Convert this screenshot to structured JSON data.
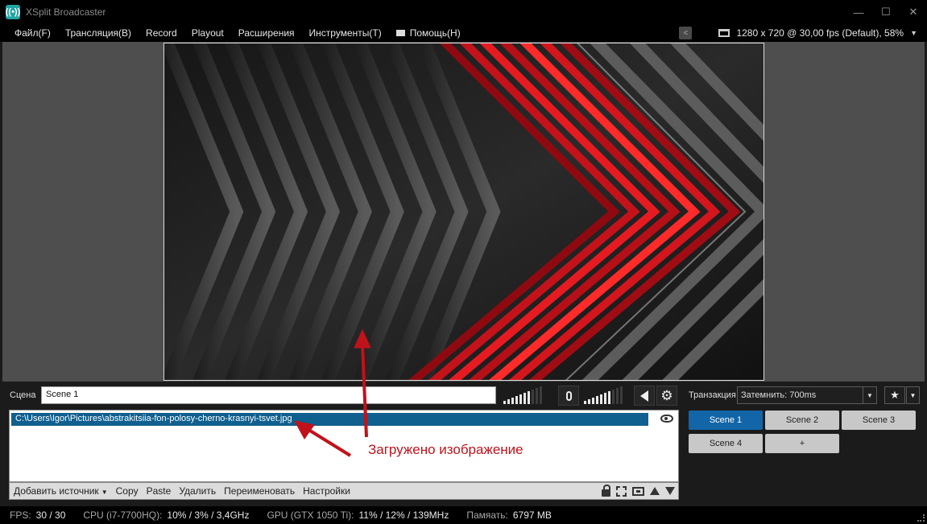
{
  "window": {
    "title": "XSplit Broadcaster",
    "minimize": "—",
    "maximize": "☐",
    "close": "✕"
  },
  "menu": [
    {
      "label": "Файл(F)"
    },
    {
      "label": "Трансляция(B)"
    },
    {
      "label": "Record"
    },
    {
      "label": "Playout"
    },
    {
      "label": "Расширения"
    },
    {
      "label": "Инструменты(T)"
    },
    {
      "label": "Помощь(H)"
    }
  ],
  "resolution": "1280 x 720 @ 30,00 fps (Default), 58%",
  "scene": {
    "label": "Сцена",
    "name": "Scene 1"
  },
  "audio": {
    "mic_level": 0.7,
    "speaker_level": 0.7
  },
  "sources": [
    {
      "path": "C:\\Users\\Igor\\Pictures\\abstrakitsiia-fon-polosy-cherno-krasnyi-tsvet.jpg",
      "selected": true
    }
  ],
  "source_toolbar": {
    "add": "Добавить источник",
    "copy": "Copy",
    "paste": "Paste",
    "delete": "Удалить",
    "rename": "Переименовать",
    "settings": "Настройки"
  },
  "transition": {
    "label": "Транзакция",
    "value": "Затемнить: 700ms"
  },
  "scenes": [
    {
      "label": "Scene 1",
      "active": true
    },
    {
      "label": "Scene 2",
      "active": false
    },
    {
      "label": "Scene 3",
      "active": false
    },
    {
      "label": "Scene 4",
      "active": false
    },
    {
      "label": "+",
      "active": false
    }
  ],
  "annotation": "Загружено изображение",
  "status": {
    "fps_label": "FPS:",
    "fps": "30 / 30",
    "cpu_label": "CPU (i7-7700HQ):",
    "cpu": "10% / 3% / 3,4GHz",
    "gpu_label": "GPU (GTX 1050 Ti):",
    "gpu": "11% / 12% / 139MHz",
    "mem_label": "Памяать:",
    "mem": "6797 MB"
  },
  "colors": {
    "accent": "#1266a8",
    "selection": "#0f5f8f",
    "annotation": "#c0121b"
  }
}
